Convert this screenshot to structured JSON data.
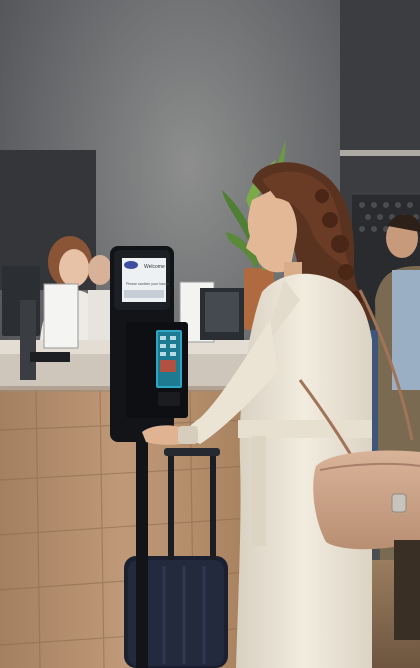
{
  "scene": {
    "kiosk": {
      "brand_mark": "ARA",
      "screen_heading": "Welcome",
      "screen_subtext": "Please sanitize your hands"
    },
    "colors": {
      "wall": "#5d5f60",
      "ceiling_frame": "#2c2e2f",
      "counter_top": "#cfc6bb",
      "counter_wood": "#b48f6f",
      "coat": "#eee7d9",
      "hair": "#5a3220",
      "bag": "#cfa58a",
      "kiosk_body": "#121418",
      "kiosk_screen_accent": "#2aa8c4",
      "plant": "#5f8d3c",
      "suitcase": "#1a2030",
      "floor": "#8a6f54"
    }
  }
}
